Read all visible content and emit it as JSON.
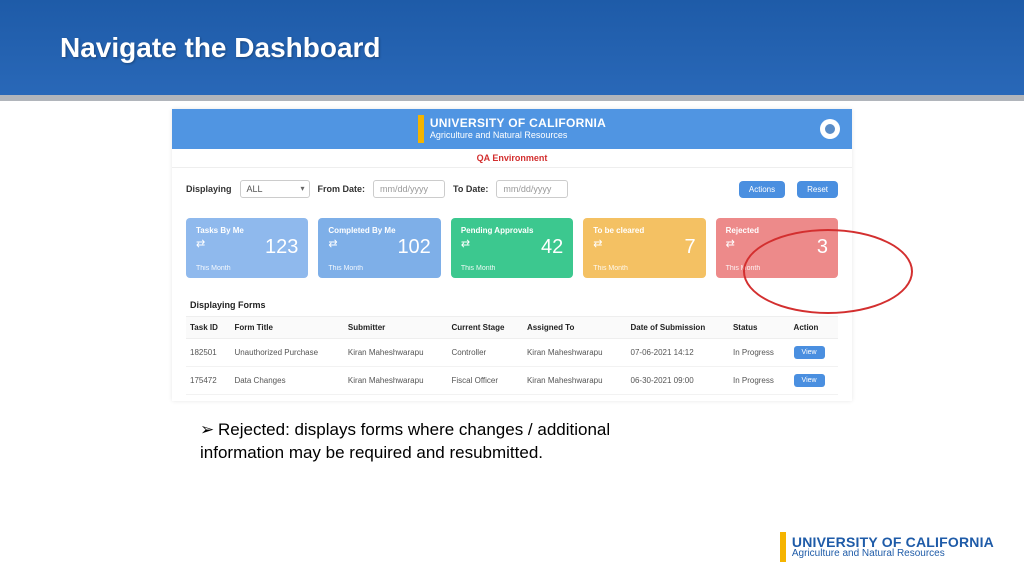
{
  "slide": {
    "title": "Navigate the Dashboard"
  },
  "banner": {
    "title": "UNIVERSITY OF CALIFORNIA",
    "subtitle": "Agriculture and Natural Resources"
  },
  "env": "QA Environment",
  "filter": {
    "displaying_label": "Displaying",
    "displaying_value": "ALL",
    "from_label": "From Date:",
    "from_placeholder": "mm/dd/yyyy",
    "to_label": "To Date:",
    "to_placeholder": "mm/dd/yyyy",
    "btn1": "Actions",
    "btn2": "Reset"
  },
  "cards": [
    {
      "title": "Tasks By Me",
      "value": "123",
      "period": "This Month"
    },
    {
      "title": "Completed By Me",
      "value": "102",
      "period": "This Month"
    },
    {
      "title": "Pending Approvals",
      "value": "42",
      "period": "This Month"
    },
    {
      "title": "To be cleared",
      "value": "7",
      "period": "This Month"
    },
    {
      "title": "Rejected",
      "value": "3",
      "period": "This Month"
    }
  ],
  "section_title": "Displaying Forms",
  "table": {
    "headers": [
      "Task ID",
      "Form Title",
      "Submitter",
      "Current Stage",
      "Assigned To",
      "Date of Submission",
      "Status",
      "Action"
    ],
    "rows": [
      {
        "id": "182501",
        "title": "Unauthorized Purchase",
        "submitter": "Kiran Maheshwarapu",
        "stage": "Controller",
        "assigned": "Kiran Maheshwarapu",
        "date": "07-06-2021 14:12",
        "status": "In Progress",
        "action": "View"
      },
      {
        "id": "175472",
        "title": "Data Changes",
        "submitter": "Kiran Maheshwarapu",
        "stage": "Fiscal Officer",
        "assigned": "Kiran Maheshwarapu",
        "date": "06-30-2021 09:00",
        "status": "In Progress",
        "action": "View"
      }
    ]
  },
  "bullet": "Rejected: displays forms where changes / additional information may be required and resubmitted.",
  "footer": {
    "title": "UNIVERSITY OF CALIFORNIA",
    "subtitle": "Agriculture and Natural Resources"
  }
}
